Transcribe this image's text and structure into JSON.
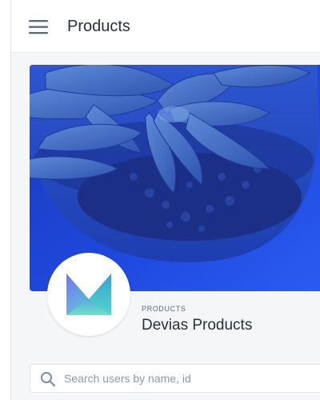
{
  "header": {
    "title": "Products",
    "menu_icon": "hamburger-menu-icon"
  },
  "profile": {
    "overline": "PRODUCTS",
    "name": "Devias Products",
    "cover_image": "succulent-plant-in-pot",
    "logo_icon": "devias-logo-icon"
  },
  "search": {
    "placeholder": "Search users by name, id",
    "value": "",
    "icon": "search-icon"
  },
  "colors": {
    "cover_primary": "#1e3fd6",
    "cover_dark": "#152a8a",
    "logo_start": "#2f5cf0",
    "logo_end": "#6fe0c8",
    "text_primary": "#263238",
    "text_secondary": "#546e7a"
  }
}
